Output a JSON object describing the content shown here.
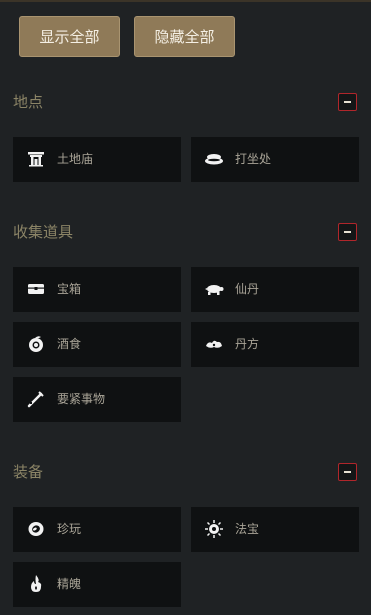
{
  "toolbar": {
    "show_all_label": "显示全部",
    "hide_all_label": "隐藏全部"
  },
  "sections": [
    {
      "title": "地点",
      "items": [
        {
          "label": "土地庙",
          "icon": "shrine-icon"
        },
        {
          "label": "打坐处",
          "icon": "meditation-cushion-icon"
        }
      ]
    },
    {
      "title": "收集道具",
      "items": [
        {
          "label": "宝箱",
          "icon": "treasure-chest-icon"
        },
        {
          "label": "仙丹",
          "icon": "turtle-elixir-icon"
        },
        {
          "label": "酒食",
          "icon": "peach-food-icon"
        },
        {
          "label": "丹方",
          "icon": "cloud-recipe-icon"
        },
        {
          "label": "要紧事物",
          "icon": "key-item-icon"
        }
      ]
    },
    {
      "title": "装备",
      "items": [
        {
          "label": "珍玩",
          "icon": "ring-curio-icon"
        },
        {
          "label": "法宝",
          "icon": "magic-artifact-icon"
        },
        {
          "label": "精魄",
          "icon": "spirit-flame-icon"
        }
      ]
    }
  ],
  "colors": {
    "background": "#1f2224",
    "button": "#8f7a58",
    "section_title": "#8b8466",
    "collapse_border": "#b0262b",
    "item_background": "#0f1112"
  }
}
